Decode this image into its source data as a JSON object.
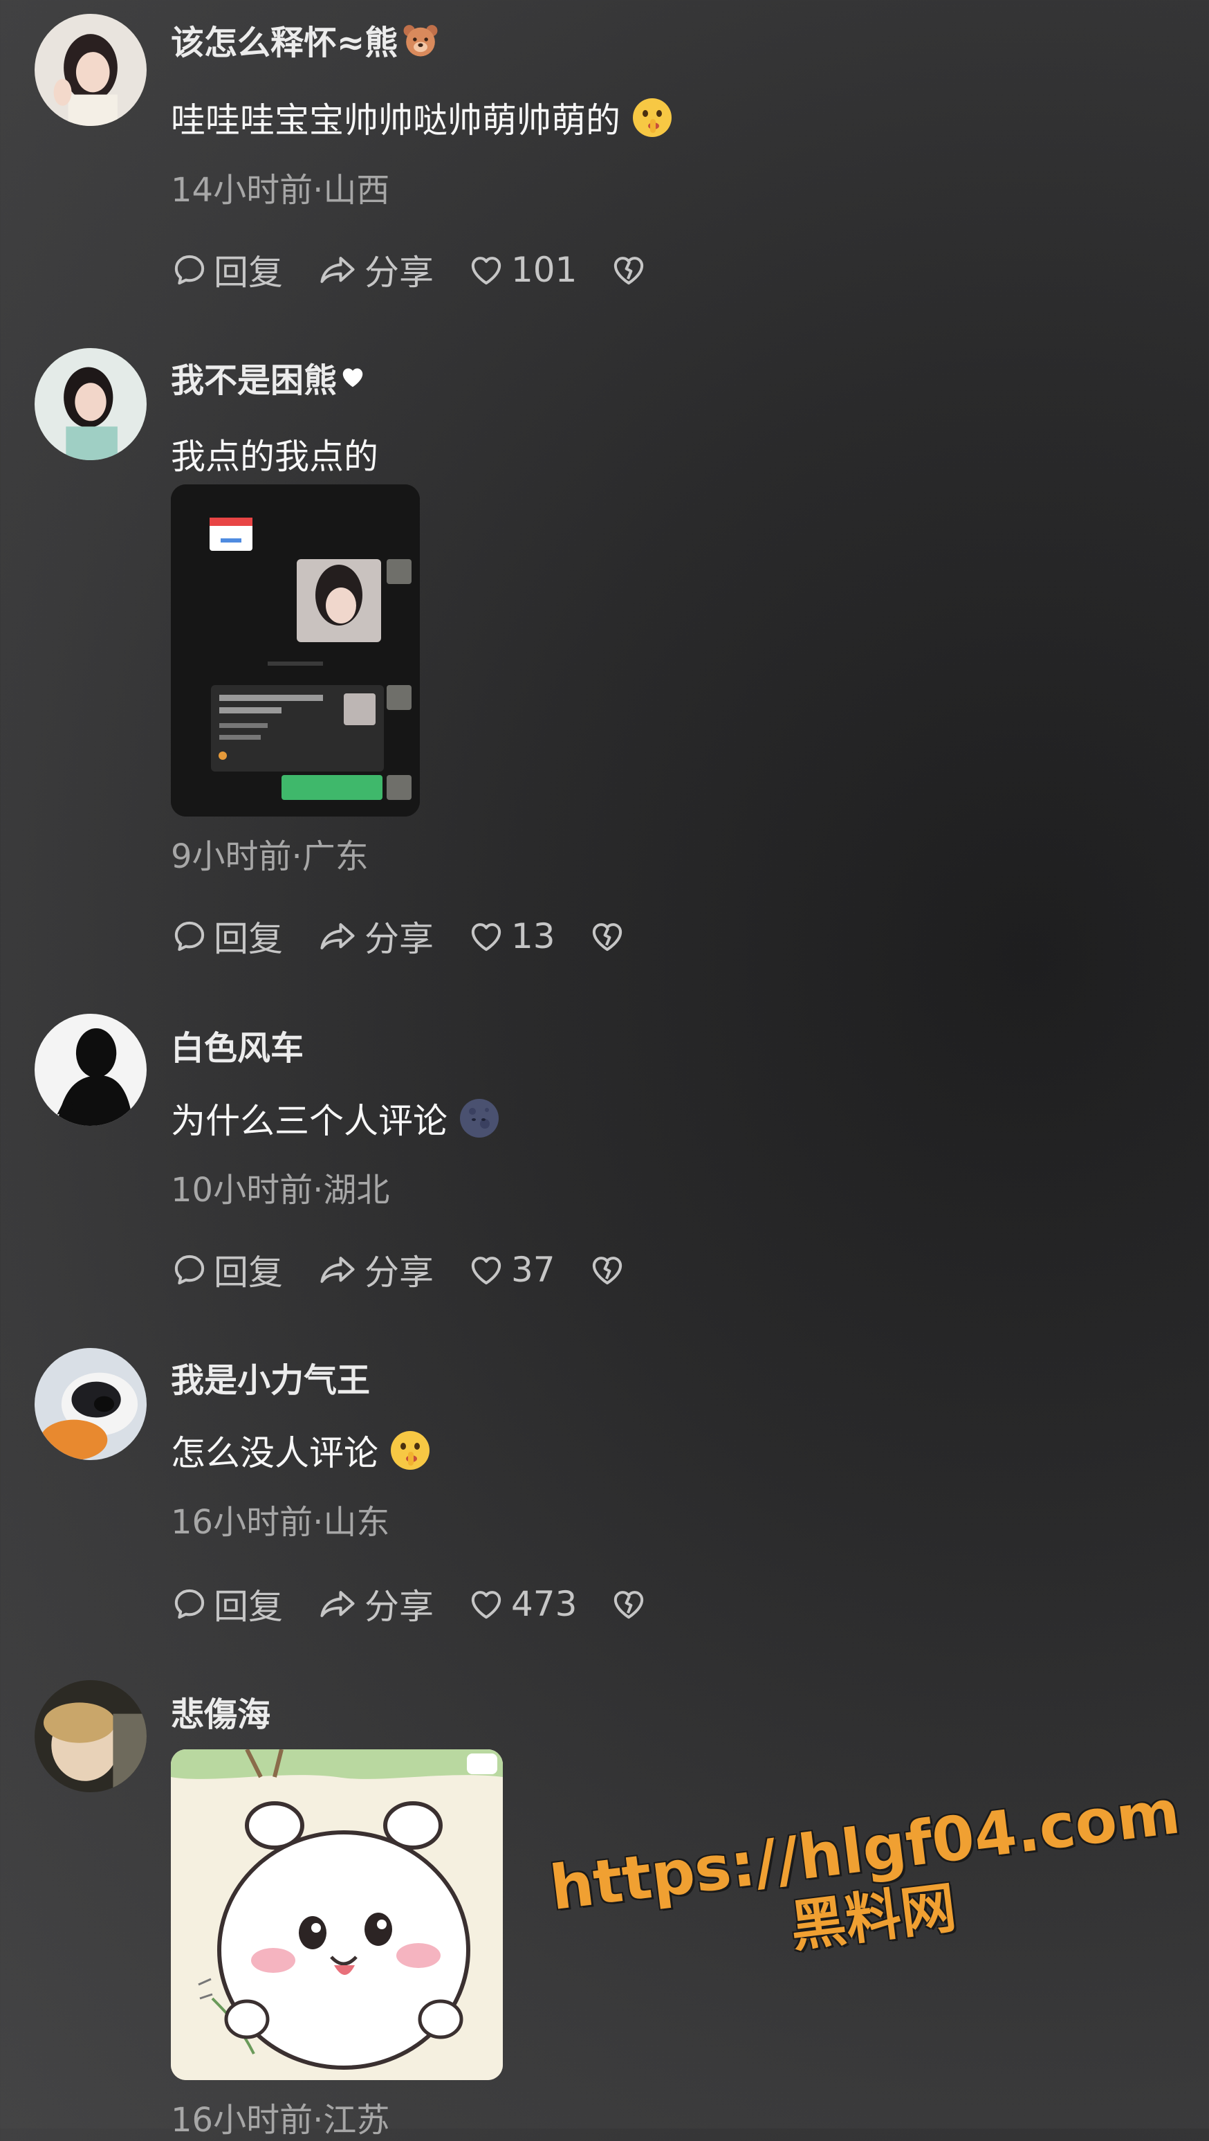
{
  "comments": [
    {
      "username": "该怎么释怀≈熊",
      "text": "哇哇哇宝宝帅帅哒帅萌帅萌的",
      "meta": "14小时前·山西",
      "reply_label": "回复",
      "share_label": "分享",
      "likes": "101"
    },
    {
      "username": "我不是困熊",
      "text": "我点的我点的",
      "meta": "9小时前·广东",
      "reply_label": "回复",
      "share_label": "分享",
      "likes": "13"
    },
    {
      "username": "白色风车",
      "text": "为什么三个人评论",
      "meta": "10小时前·湖北",
      "reply_label": "回复",
      "share_label": "分享",
      "likes": "37"
    },
    {
      "username": "我是小力气王",
      "text": "怎么没人评论",
      "meta": "16小时前·山东",
      "reply_label": "回复",
      "share_label": "分享",
      "likes": "473"
    },
    {
      "username": "悲傷海",
      "meta": "16小时前·江苏"
    }
  ],
  "watermark": {
    "url": "https://hlgf04.com",
    "name": "黑料网"
  },
  "colors": {
    "accent_watermark": "#f0a032",
    "meta_text": "#a7a7a7",
    "action_text": "#c6c6c6"
  },
  "icons": [
    "reply-icon",
    "share-icon",
    "heart-icon",
    "broken-heart-icon",
    "bear-emoji",
    "white-heart-emoji",
    "shush-emoji",
    "moon-emoji"
  ]
}
